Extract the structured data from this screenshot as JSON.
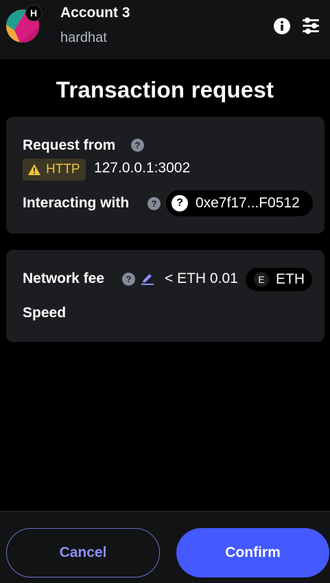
{
  "header": {
    "account_name": "Account 3",
    "network_name": "hardhat",
    "network_badge": "H",
    "icons": {
      "info": "info-icon",
      "settings": "sliders-icon"
    }
  },
  "title": "Transaction request",
  "request_card": {
    "request_from_label": "Request from",
    "protocol_badge": "HTTP",
    "origin": "127.0.0.1:3002",
    "interacting_with_label": "Interacting with",
    "contract_address": "0xe7f17...F0512"
  },
  "fee_card": {
    "network_fee_label": "Network fee",
    "fee_value": "< ETH 0.01",
    "token_letter": "E",
    "token_symbol": "ETH",
    "speed_label": "Speed"
  },
  "footer": {
    "cancel_label": "Cancel",
    "confirm_label": "Confirm"
  },
  "colors": {
    "background": "#000000",
    "card": "#1c1d20",
    "header": "#121314",
    "primary": "#4459ff",
    "cancel_text": "#8b90ff",
    "warning": "#f0c437"
  }
}
